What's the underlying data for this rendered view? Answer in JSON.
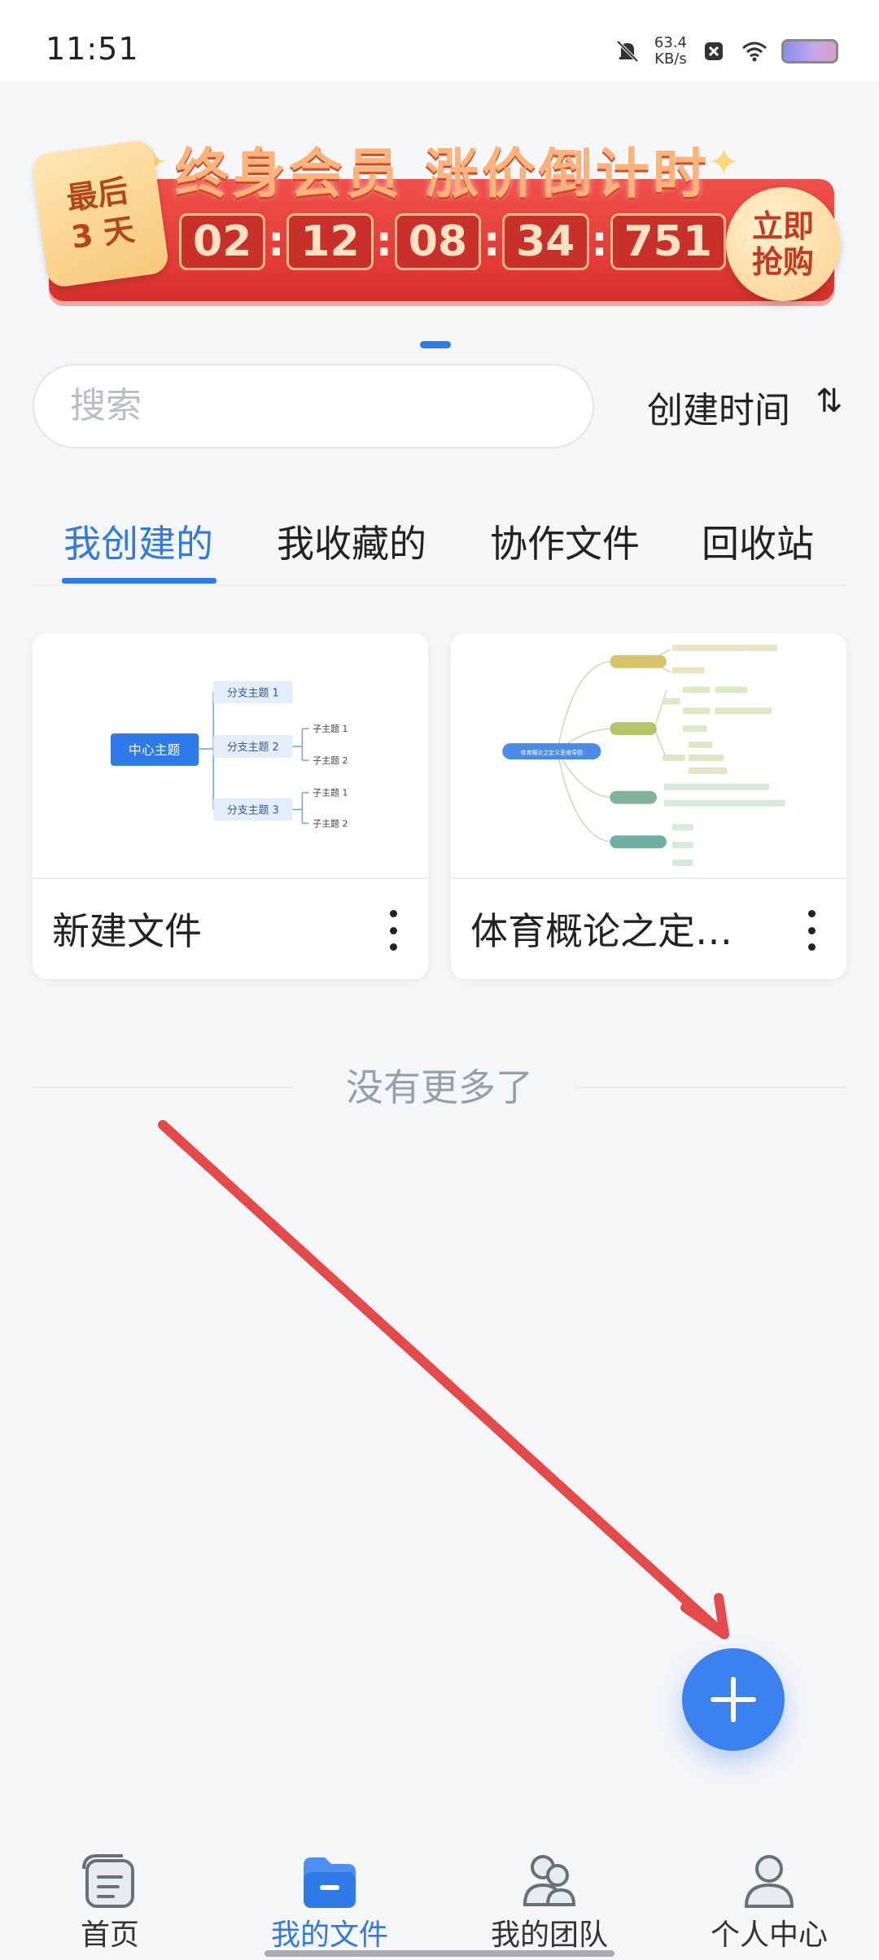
{
  "status_bar": {
    "time": "11:51",
    "speed_value": "63.4",
    "speed_unit": "KB/s",
    "icons": [
      "mute-bell-icon",
      "close-notification-icon",
      "wifi-icon",
      "battery-icon"
    ]
  },
  "banner": {
    "title": "终身会员 涨价倒计时",
    "badge_line1": "最后",
    "badge_line2": "3 天",
    "countdown": [
      "02",
      "12",
      "08",
      "34",
      "751"
    ],
    "buy_line1": "立即",
    "buy_line2": "抢购"
  },
  "search": {
    "placeholder": "搜索"
  },
  "sort": {
    "label": "创建时间",
    "icon": "⇅"
  },
  "tabs": [
    {
      "label": "我创建的",
      "active": true
    },
    {
      "label": "我收藏的",
      "active": false
    },
    {
      "label": "协作文件",
      "active": false
    },
    {
      "label": "回收站",
      "active": false
    }
  ],
  "files": [
    {
      "name": "新建文件",
      "thumbnail": {
        "center": "中心主题",
        "branches": [
          "分支主题 1",
          "分支主题 2",
          "分支主题 3"
        ],
        "subtopics": [
          "子主题 1",
          "子主题 2",
          "子主题 1",
          "子主题 2"
        ]
      }
    },
    {
      "name": "体育概论之定…",
      "thumbnail": {
        "center": "体育概论之定义思维导图"
      }
    }
  ],
  "list_end_text": "没有更多了",
  "colors": {
    "accent": "#2f7ae8",
    "fab": "#3b82f0",
    "banner_red": "#e23a36",
    "arrow_red": "#e5494a"
  },
  "bottom_nav": [
    {
      "label": "首页",
      "icon": "home-doc-icon",
      "active": false
    },
    {
      "label": "我的文件",
      "icon": "folder-icon",
      "active": true
    },
    {
      "label": "我的团队",
      "icon": "team-icon",
      "active": false
    },
    {
      "label": "个人中心",
      "icon": "profile-icon",
      "active": false
    }
  ]
}
